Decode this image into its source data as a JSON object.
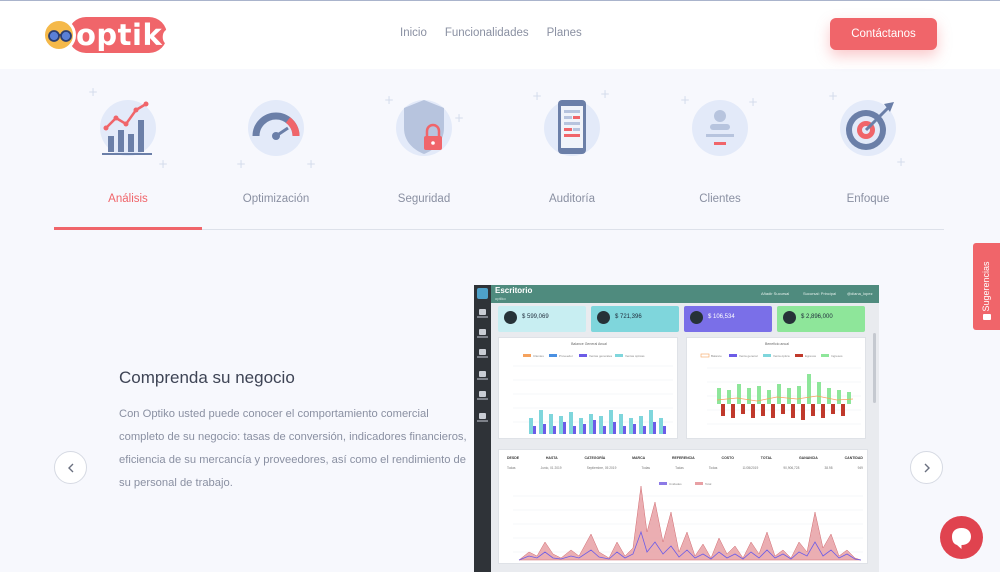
{
  "header": {
    "brand": "optiko",
    "nav": [
      "Inicio",
      "Funcionalidades",
      "Planes"
    ],
    "contact_label": "Contáctanos"
  },
  "features": {
    "active_index": 0,
    "items": [
      {
        "label": "Análisis",
        "icon": "chart-growth-icon"
      },
      {
        "label": "Optimización",
        "icon": "speedometer-icon"
      },
      {
        "label": "Seguridad",
        "icon": "shield-lock-icon"
      },
      {
        "label": "Auditoría",
        "icon": "mobile-report-icon"
      },
      {
        "label": "Clientes",
        "icon": "user-card-icon"
      },
      {
        "label": "Enfoque",
        "icon": "target-icon"
      }
    ]
  },
  "slide": {
    "title": "Comprenda su negocio",
    "text": "Con Optiko usted puede conocer el comportamiento comercial completo de su negocio: tasas de conversión, indicadores financieros, eficiencia de su mercancía y proveedores, así como el rendimiento de su personal de trabajo.",
    "prev_icon": "chevron-left-icon",
    "next_icon": "chevron-right-icon"
  },
  "dashboard": {
    "title": "Escritorio",
    "subtitle": "optiko",
    "topbar_right": [
      "Añadir Sucursal",
      "Sucursal: Principal",
      "@diana_lopez"
    ],
    "kpis": [
      {
        "value": "$ 599,069",
        "color": "#c8eef2"
      },
      {
        "value": "$ 721,396",
        "color": "#7fd6dc"
      },
      {
        "value": "$ 106,534",
        "color": "#7a6fe8"
      },
      {
        "value": "$ 2,896,000",
        "color": "#8ee69a"
      }
    ],
    "chart1_title": "Balance General Anual",
    "chart2_title": "Beneficio anual",
    "chart1_legend": [
      "Clientes",
      "Proveedor",
      "Ventas generales",
      "Ventas ópticas"
    ],
    "chart2_legend": [
      "Balance",
      "Venta general",
      "Venta óptica",
      "Egresos",
      "Ingresos"
    ],
    "table_headers": [
      "DESDE",
      "HASTA",
      "CATEGORÍA",
      "MARCA",
      "REFERENCIA",
      "COSTO",
      "TOTAL",
      "GANANCIA",
      "CANTIDAD"
    ],
    "table_row": [
      "Todas",
      "Junio, 01 2019",
      "Septiembre, 05 2019",
      "Todas",
      "Todas",
      "Todas",
      "11/05/2019",
      "90,906,728",
      "38.98",
      "949"
    ],
    "chart3_legend": [
      "Unidades",
      "Total"
    ]
  },
  "widgets": {
    "suggestions_label": "Sugerencias",
    "chat_icon": "chat-bubble-icon"
  },
  "colors": {
    "accent": "#f0656a",
    "icon_circle": "#e3eaf9",
    "icon_blue": "#6b7fa8",
    "dashboard_header": "#4f8b7e"
  }
}
